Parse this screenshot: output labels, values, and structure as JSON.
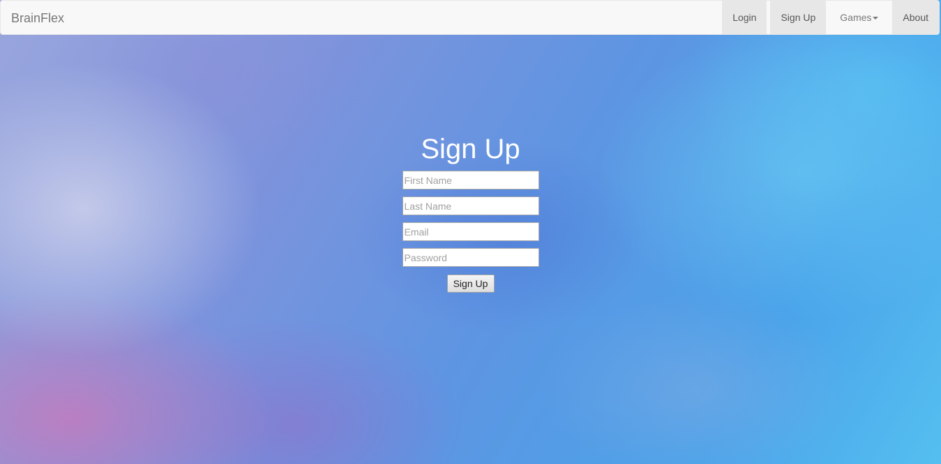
{
  "navbar": {
    "brand": "BrainFlex",
    "items": [
      {
        "label": "Login"
      },
      {
        "label": "Sign Up"
      },
      {
        "label": "Games"
      },
      {
        "label": "About"
      }
    ]
  },
  "signup": {
    "title": "Sign Up",
    "fields": {
      "first_name": {
        "placeholder": "First Name",
        "value": ""
      },
      "last_name": {
        "placeholder": "Last Name",
        "value": ""
      },
      "email": {
        "placeholder": "Email",
        "value": ""
      },
      "password": {
        "placeholder": "Password",
        "value": ""
      }
    },
    "submit_label": "Sign Up"
  },
  "icons": {
    "games_dropdown": "caret-down-icon"
  },
  "colors": {
    "navbar_bg": "#f8f8f8",
    "active_nav_bg": "#e7e7e7",
    "title_text": "#ffffff"
  }
}
